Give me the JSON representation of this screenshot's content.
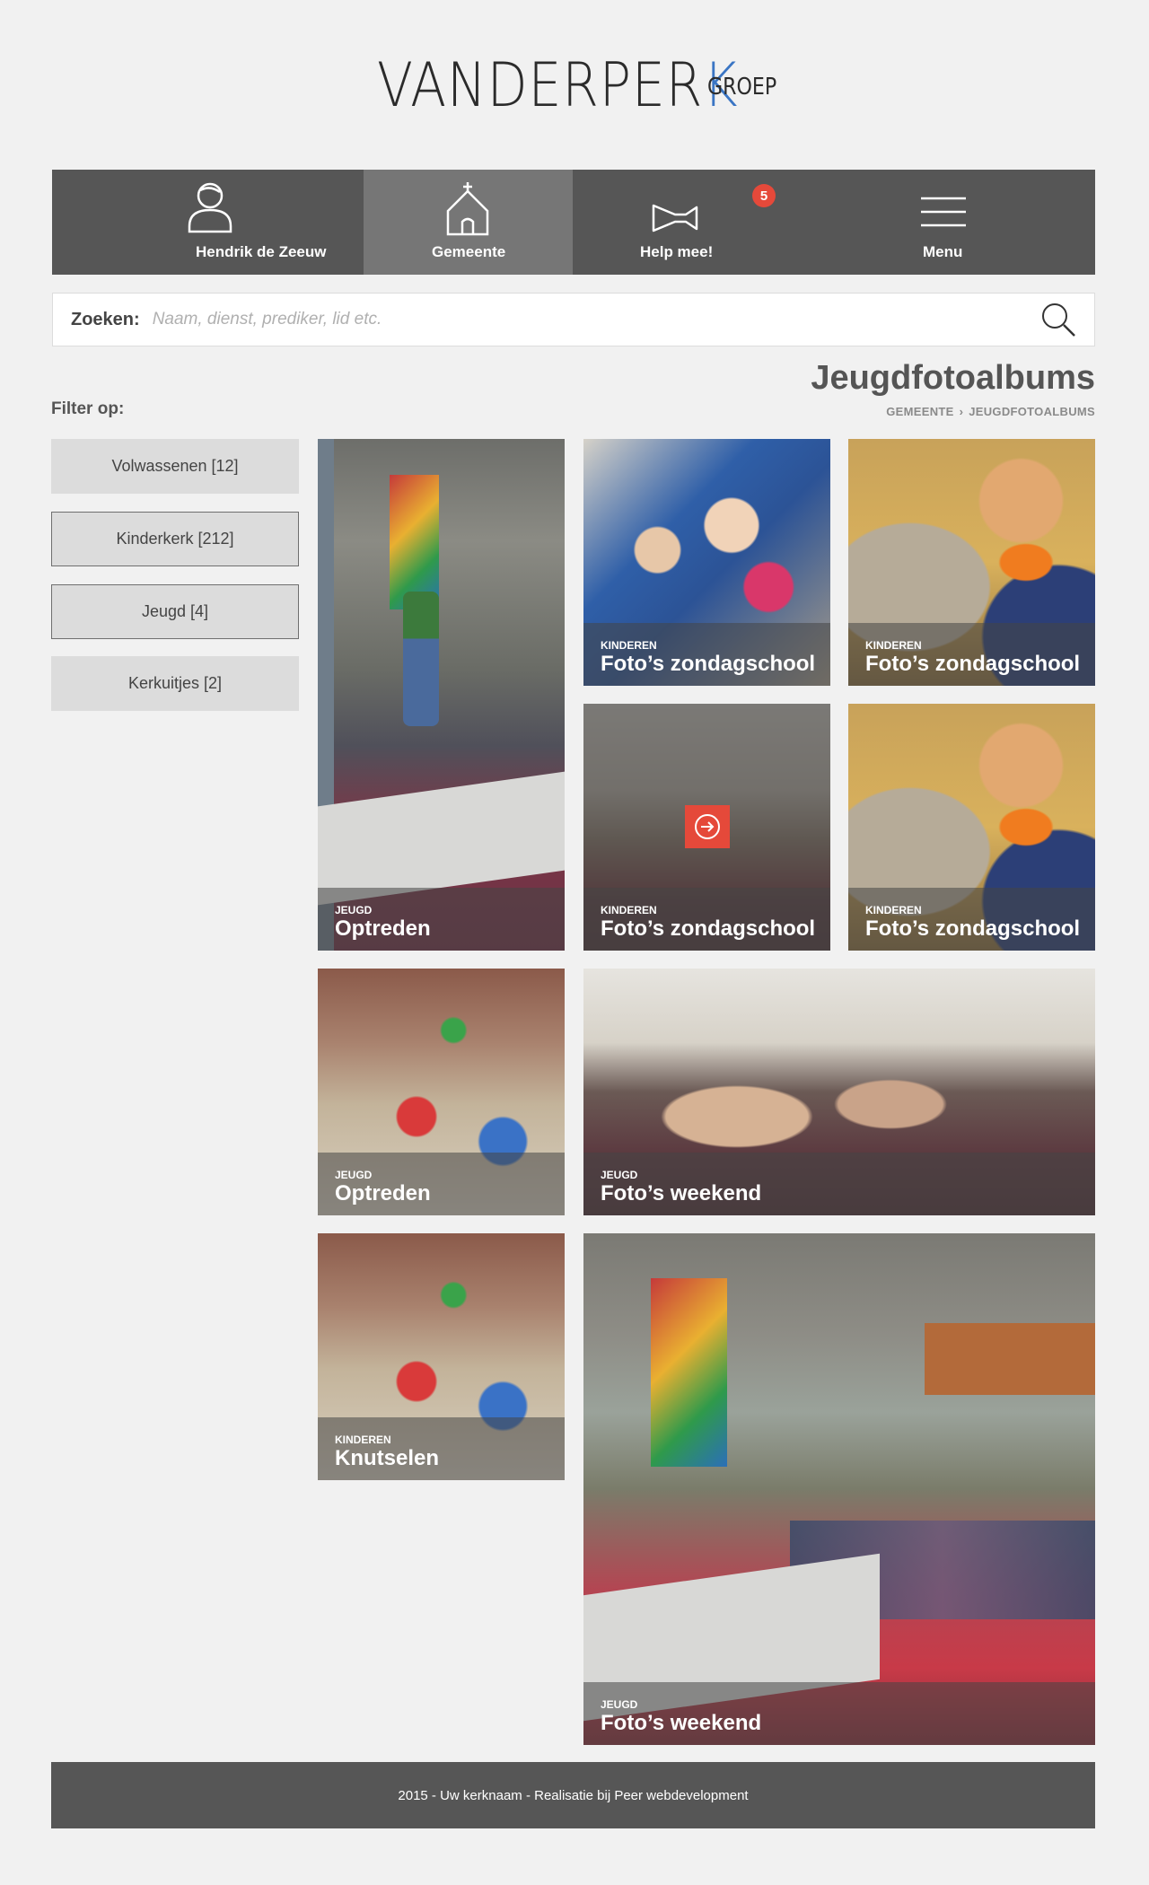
{
  "logo": {
    "main_prefix": "VANDERPER",
    "main_k": "K",
    "sub": "GROEP"
  },
  "nav": {
    "items": [
      {
        "label": "Hendrik de Zeeuw",
        "icon": "user-icon"
      },
      {
        "label": "Gemeente",
        "icon": "church-icon",
        "active": true
      },
      {
        "label": "Help mee!",
        "icon": "megaphone-icon",
        "badge": "5"
      },
      {
        "label": "Menu",
        "icon": "hamburger-menu-icon"
      }
    ]
  },
  "search": {
    "label": "Zoeken:",
    "placeholder": "Naam, dienst, prediker, lid etc.",
    "value": ""
  },
  "page": {
    "title": "Jeugdfotoalbums"
  },
  "breadcrumb": {
    "items": [
      "GEMEENTE",
      "JEUGDFOTOALBUMS"
    ],
    "separator": "›"
  },
  "filter": {
    "label": "Filter op:",
    "options": [
      "Volwassenen [12]",
      "Kinderkerk [212]",
      "Jeugd [4]",
      "Kerkuitjes [2]"
    ]
  },
  "albums": [
    {
      "category": "JEUGD",
      "title": "Optreden"
    },
    {
      "category": "KINDEREN",
      "title": "Foto’s zondagschool"
    },
    {
      "category": "KINDEREN",
      "title": "Foto’s zondagschool"
    },
    {
      "category": "KINDEREN",
      "title": "Foto’s zondagschool"
    },
    {
      "category": "KINDEREN",
      "title": "Foto’s zondagschool"
    },
    {
      "category": "JEUGD",
      "title": "Optreden"
    },
    {
      "category": "JEUGD",
      "title": "Foto’s weekend"
    },
    {
      "category": "KINDEREN",
      "title": "Knutselen"
    },
    {
      "category": "JEUGD",
      "title": "Foto’s weekend"
    }
  ],
  "footer": {
    "text": "2015 - Uw kerknaam - Realisatie bij Peer webdevelopment"
  },
  "colors": {
    "accent": "#e5493a",
    "nav_bg": "#565656",
    "nav_active": "#767676",
    "logo_k": "#3a75c4"
  }
}
